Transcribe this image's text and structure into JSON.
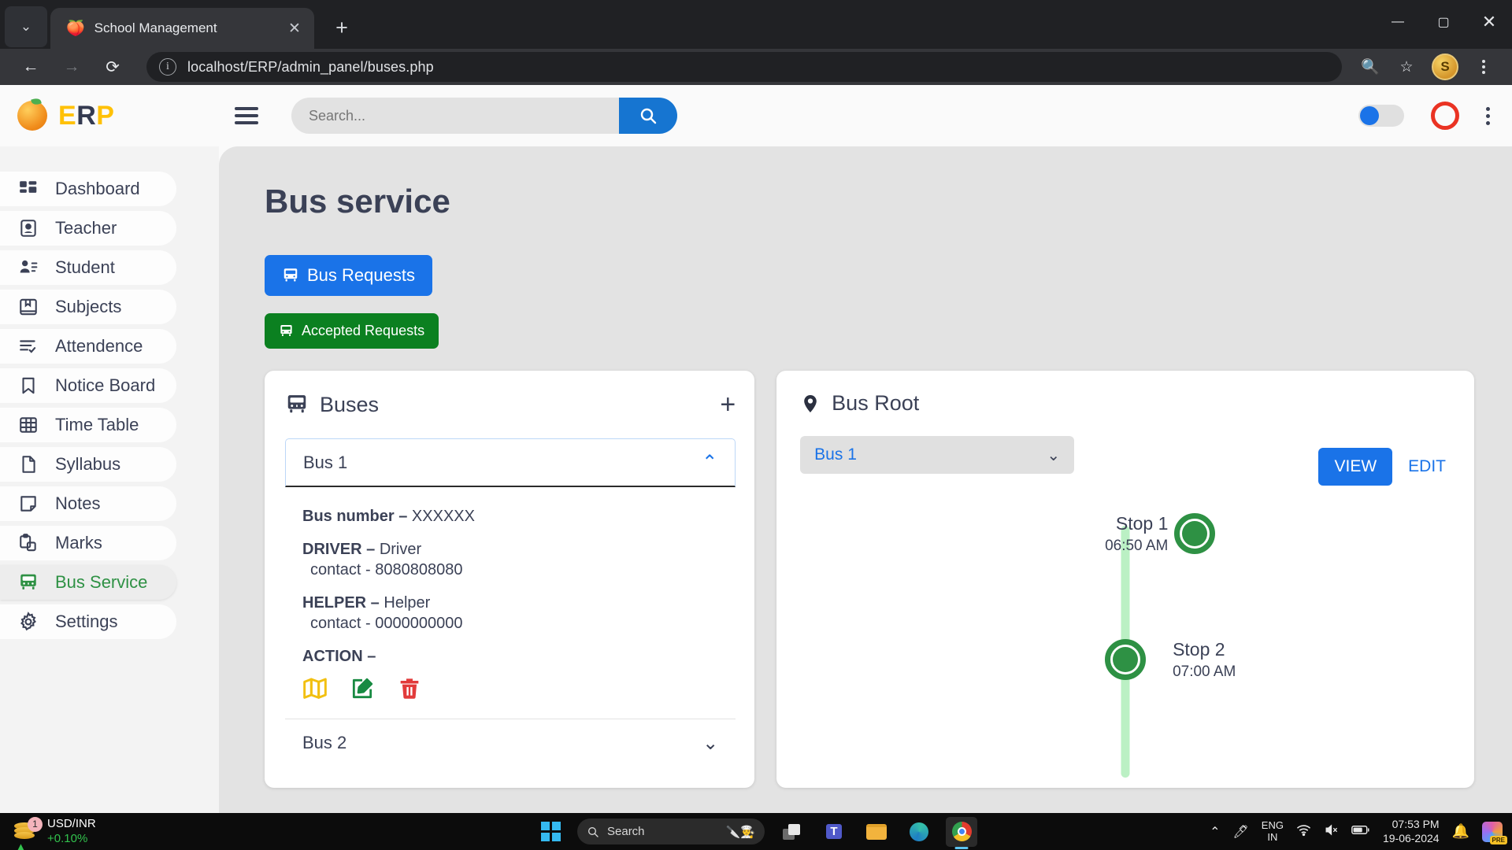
{
  "browser": {
    "tab": {
      "title": "School Management",
      "favicon": "🍑",
      "close_label": "✕"
    },
    "newtab_label": "+",
    "tab_list_chevron": "⌄",
    "window": {
      "minimize": "—",
      "maximize": "▢",
      "close": "✕"
    },
    "nav": {
      "back": "←",
      "forward": "→",
      "reload": "⟳"
    },
    "url": "localhost/ERP/admin_panel/buses.php",
    "info_icon": "i",
    "zoom_icon": "🔍",
    "bookmark_icon": "☆",
    "profile_initial": "S"
  },
  "appbar": {
    "brand": {
      "e": "E",
      "r": "R",
      "p": "P"
    },
    "search": {
      "placeholder": "Search...",
      "value": "",
      "button_icon": "search-icon"
    }
  },
  "sidebar": {
    "items": [
      {
        "label": "Dashboard",
        "icon": "grid-icon",
        "active": false
      },
      {
        "label": "Teacher",
        "icon": "id-card-icon",
        "active": false
      },
      {
        "label": "Student",
        "icon": "user-list-icon",
        "active": false
      },
      {
        "label": "Subjects",
        "icon": "book-icon",
        "active": false
      },
      {
        "label": "Attendence",
        "icon": "checklist-icon",
        "active": false
      },
      {
        "label": "Notice Board",
        "icon": "bookmark-icon",
        "active": false
      },
      {
        "label": "Time Table",
        "icon": "table-icon",
        "active": false
      },
      {
        "label": "Syllabus",
        "icon": "file-icon",
        "active": false
      },
      {
        "label": "Notes",
        "icon": "note-icon",
        "active": false
      },
      {
        "label": "Marks",
        "icon": "clipboard-icon",
        "active": false
      },
      {
        "label": "Bus Service",
        "icon": "bus-icon",
        "active": true
      },
      {
        "label": "Settings",
        "icon": "gear-icon",
        "active": false
      }
    ]
  },
  "main": {
    "title": "Bus service",
    "buttons": {
      "bus_requests": "Bus Requests",
      "accepted_requests": "Accepted Requests"
    },
    "buses_card": {
      "title": "Buses",
      "add_label": "+",
      "expanded_bus": {
        "name": "Bus 1",
        "chevron": "⌃",
        "bus_number_label": "Bus number –",
        "bus_number_value": "XXXXXX",
        "driver_label": "DRIVER –",
        "driver_value": "Driver",
        "driver_contact": "contact - 8080808080",
        "helper_label": "HELPER –",
        "helper_value": "Helper",
        "helper_contact": "contact - 0000000000",
        "action_label": "ACTION –",
        "actions": [
          {
            "name": "map-icon",
            "color": "#f2c011"
          },
          {
            "name": "edit-icon",
            "color": "#188a42"
          },
          {
            "name": "delete-icon",
            "color": "#e23b3b"
          }
        ]
      },
      "collapsed_buses": [
        {
          "name": "Bus 2",
          "chevron": "⌄"
        }
      ]
    },
    "root_card": {
      "title": "Bus Root",
      "select_value": "Bus 1",
      "select_chevron": "⌄",
      "view_label": "VIEW",
      "edit_label": "EDIT",
      "stops": [
        {
          "name": "Stop 1",
          "time": "06:50 AM",
          "side": "left"
        },
        {
          "name": "Stop 2",
          "time": "07:00 AM",
          "side": "right"
        }
      ]
    }
  },
  "taskbar": {
    "widget": {
      "pair": "USD/INR",
      "change": "+0.10%",
      "badge": "1"
    },
    "search_placeholder": "Search",
    "apps": [
      {
        "name": "task-view-icon"
      },
      {
        "name": "teams-icon"
      },
      {
        "name": "file-explorer-icon"
      },
      {
        "name": "edge-icon"
      },
      {
        "name": "chrome-icon"
      }
    ],
    "tray": {
      "chevron": "⌃",
      "language_line1": "ENG",
      "language_line2": "IN",
      "time": "07:53 PM",
      "date": "19-06-2024"
    }
  }
}
